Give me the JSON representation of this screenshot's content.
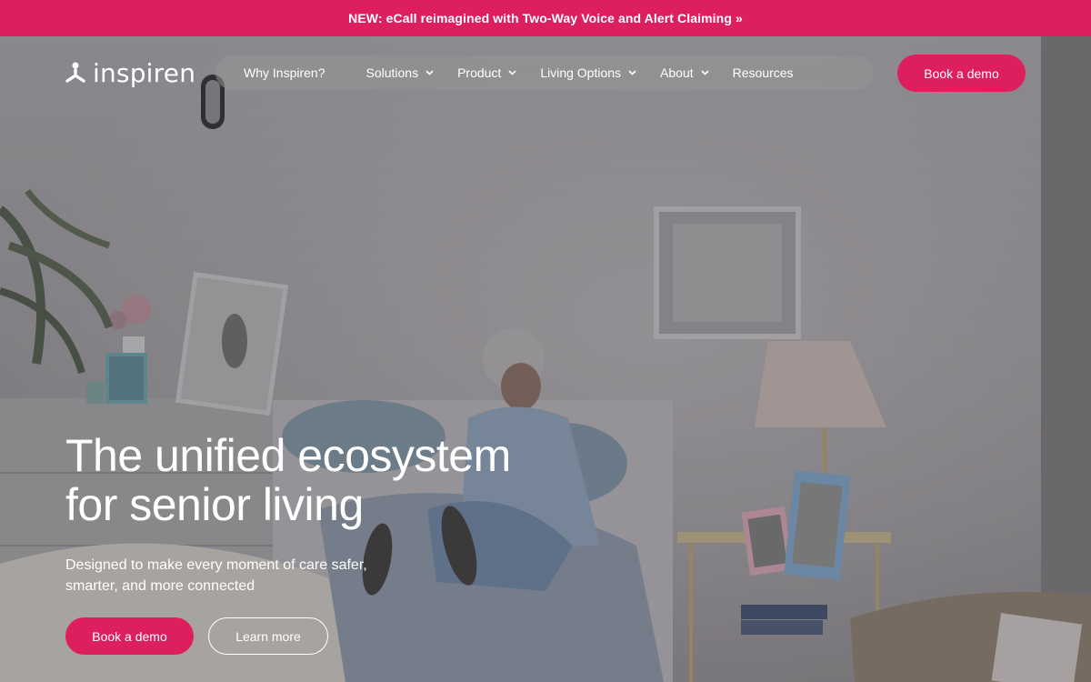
{
  "banner": {
    "text": "NEW: eCall reimagined with Two-Way Voice and Alert Claiming »"
  },
  "logo": {
    "text": "inspiren"
  },
  "nav": {
    "items": [
      {
        "label": "Why Inspiren?",
        "dropdown": false
      },
      {
        "label": "Solutions",
        "dropdown": true
      },
      {
        "label": "Product",
        "dropdown": true
      },
      {
        "label": "Living Options",
        "dropdown": true
      },
      {
        "label": "About",
        "dropdown": true
      },
      {
        "label": "Resources",
        "dropdown": false
      }
    ],
    "book_demo": "Book a demo"
  },
  "hero": {
    "headline_line1": "The unified ecosystem",
    "headline_line2": "for senior living",
    "sub_line1": "Designed to make every moment of care safer,",
    "sub_line2": "smarter, and more connected",
    "primary_cta": "Book a demo",
    "secondary_cta": "Learn more"
  },
  "colors": {
    "brand": "#dd1f5d",
    "text": "#ffffff"
  },
  "icons": {
    "logo": "inspiren-mark-icon",
    "dropdown": "chevron-down-icon"
  }
}
